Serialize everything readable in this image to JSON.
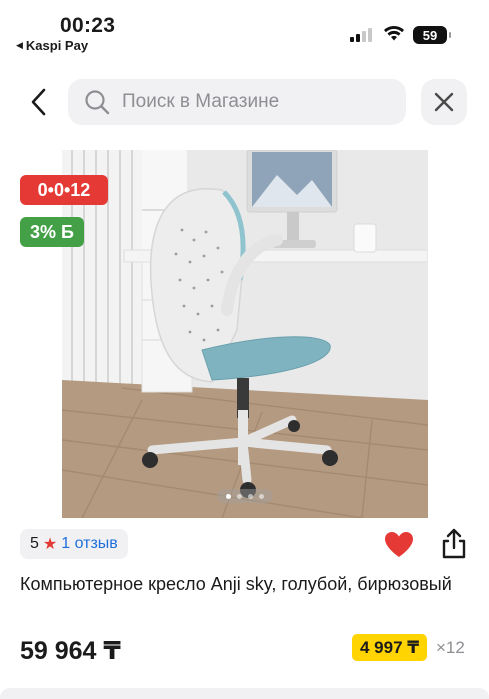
{
  "status_bar": {
    "time": "00:23",
    "back_app": "Kaspi Pay",
    "battery": "59"
  },
  "header": {
    "search_placeholder": "Поиск в Магазине"
  },
  "badges": {
    "installment": "0•0•12",
    "bonus": "3% Б"
  },
  "gallery": {
    "image_count": 4,
    "current_index": 0
  },
  "rating": {
    "score": "5",
    "reviews": "1 отзыв"
  },
  "product": {
    "title": "Компьютерное кресло Anji sky, голубой, бирюзовый",
    "price": "59 964 ₸",
    "monthly_payment": "4 997 ₸",
    "months": "×12"
  },
  "colors": {
    "installment_red": "#e53935",
    "bonus_green": "#43a047",
    "monthly_yellow": "#ffd400",
    "link_blue": "#1e6fd9",
    "heart_red": "#e53935"
  }
}
